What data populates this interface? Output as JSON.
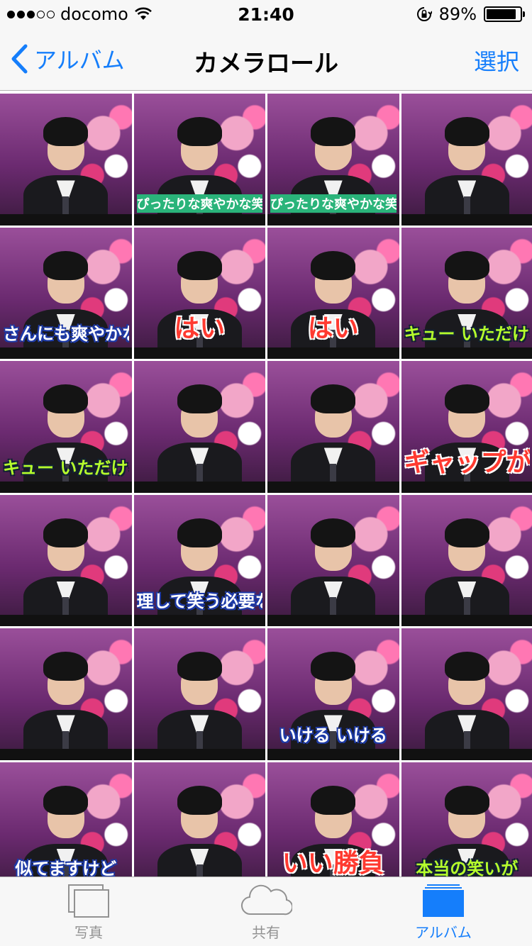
{
  "status": {
    "carrier": "docomo",
    "signal_bars_filled": 3,
    "signal_bars_total": 5,
    "time": "21:40",
    "battery_percent": "89%",
    "battery_level": 0.89
  },
  "nav": {
    "back_label": "アルバム",
    "title": "カメラロール",
    "select_label": "選択"
  },
  "photos": [
    {
      "caption": ""
    },
    {
      "caption": "ぴったりな爽やかな笑顔に癒され",
      "style": "small"
    },
    {
      "caption": "ぴったりな爽やかな笑顔に癒され",
      "style": "small"
    },
    {
      "caption": ""
    },
    {
      "caption": "さんにも爽やかな笑",
      "style": "blue"
    },
    {
      "caption": "はい",
      "style": "red"
    },
    {
      "caption": "はい",
      "style": "red"
    },
    {
      "caption": "キュー いただける",
      "style": "green"
    },
    {
      "caption": "キュー いただける",
      "style": "green"
    },
    {
      "caption": ""
    },
    {
      "caption": ""
    },
    {
      "caption": "ギャップが見たい",
      "style": "red"
    },
    {
      "caption": ""
    },
    {
      "caption": "理して笑う必要ない",
      "style": "blue"
    },
    {
      "caption": ""
    },
    {
      "caption": ""
    },
    {
      "caption": ""
    },
    {
      "caption": ""
    },
    {
      "caption": "いける いける",
      "style": "blue"
    },
    {
      "caption": ""
    },
    {
      "caption": "似てますけど",
      "style": "blue"
    },
    {
      "caption": ""
    },
    {
      "caption": "いい勝負",
      "style": "red"
    },
    {
      "caption": "本当の笑いが",
      "style": "green"
    }
  ],
  "tabs": [
    {
      "label": "写真",
      "icon": "photos-icon",
      "active": false
    },
    {
      "label": "共有",
      "icon": "cloud-icon",
      "active": false
    },
    {
      "label": "アルバム",
      "icon": "albums-icon",
      "active": true
    }
  ],
  "colors": {
    "accent": "#157efb",
    "inactive": "#929292",
    "bar_bg": "#f7f7f7"
  }
}
